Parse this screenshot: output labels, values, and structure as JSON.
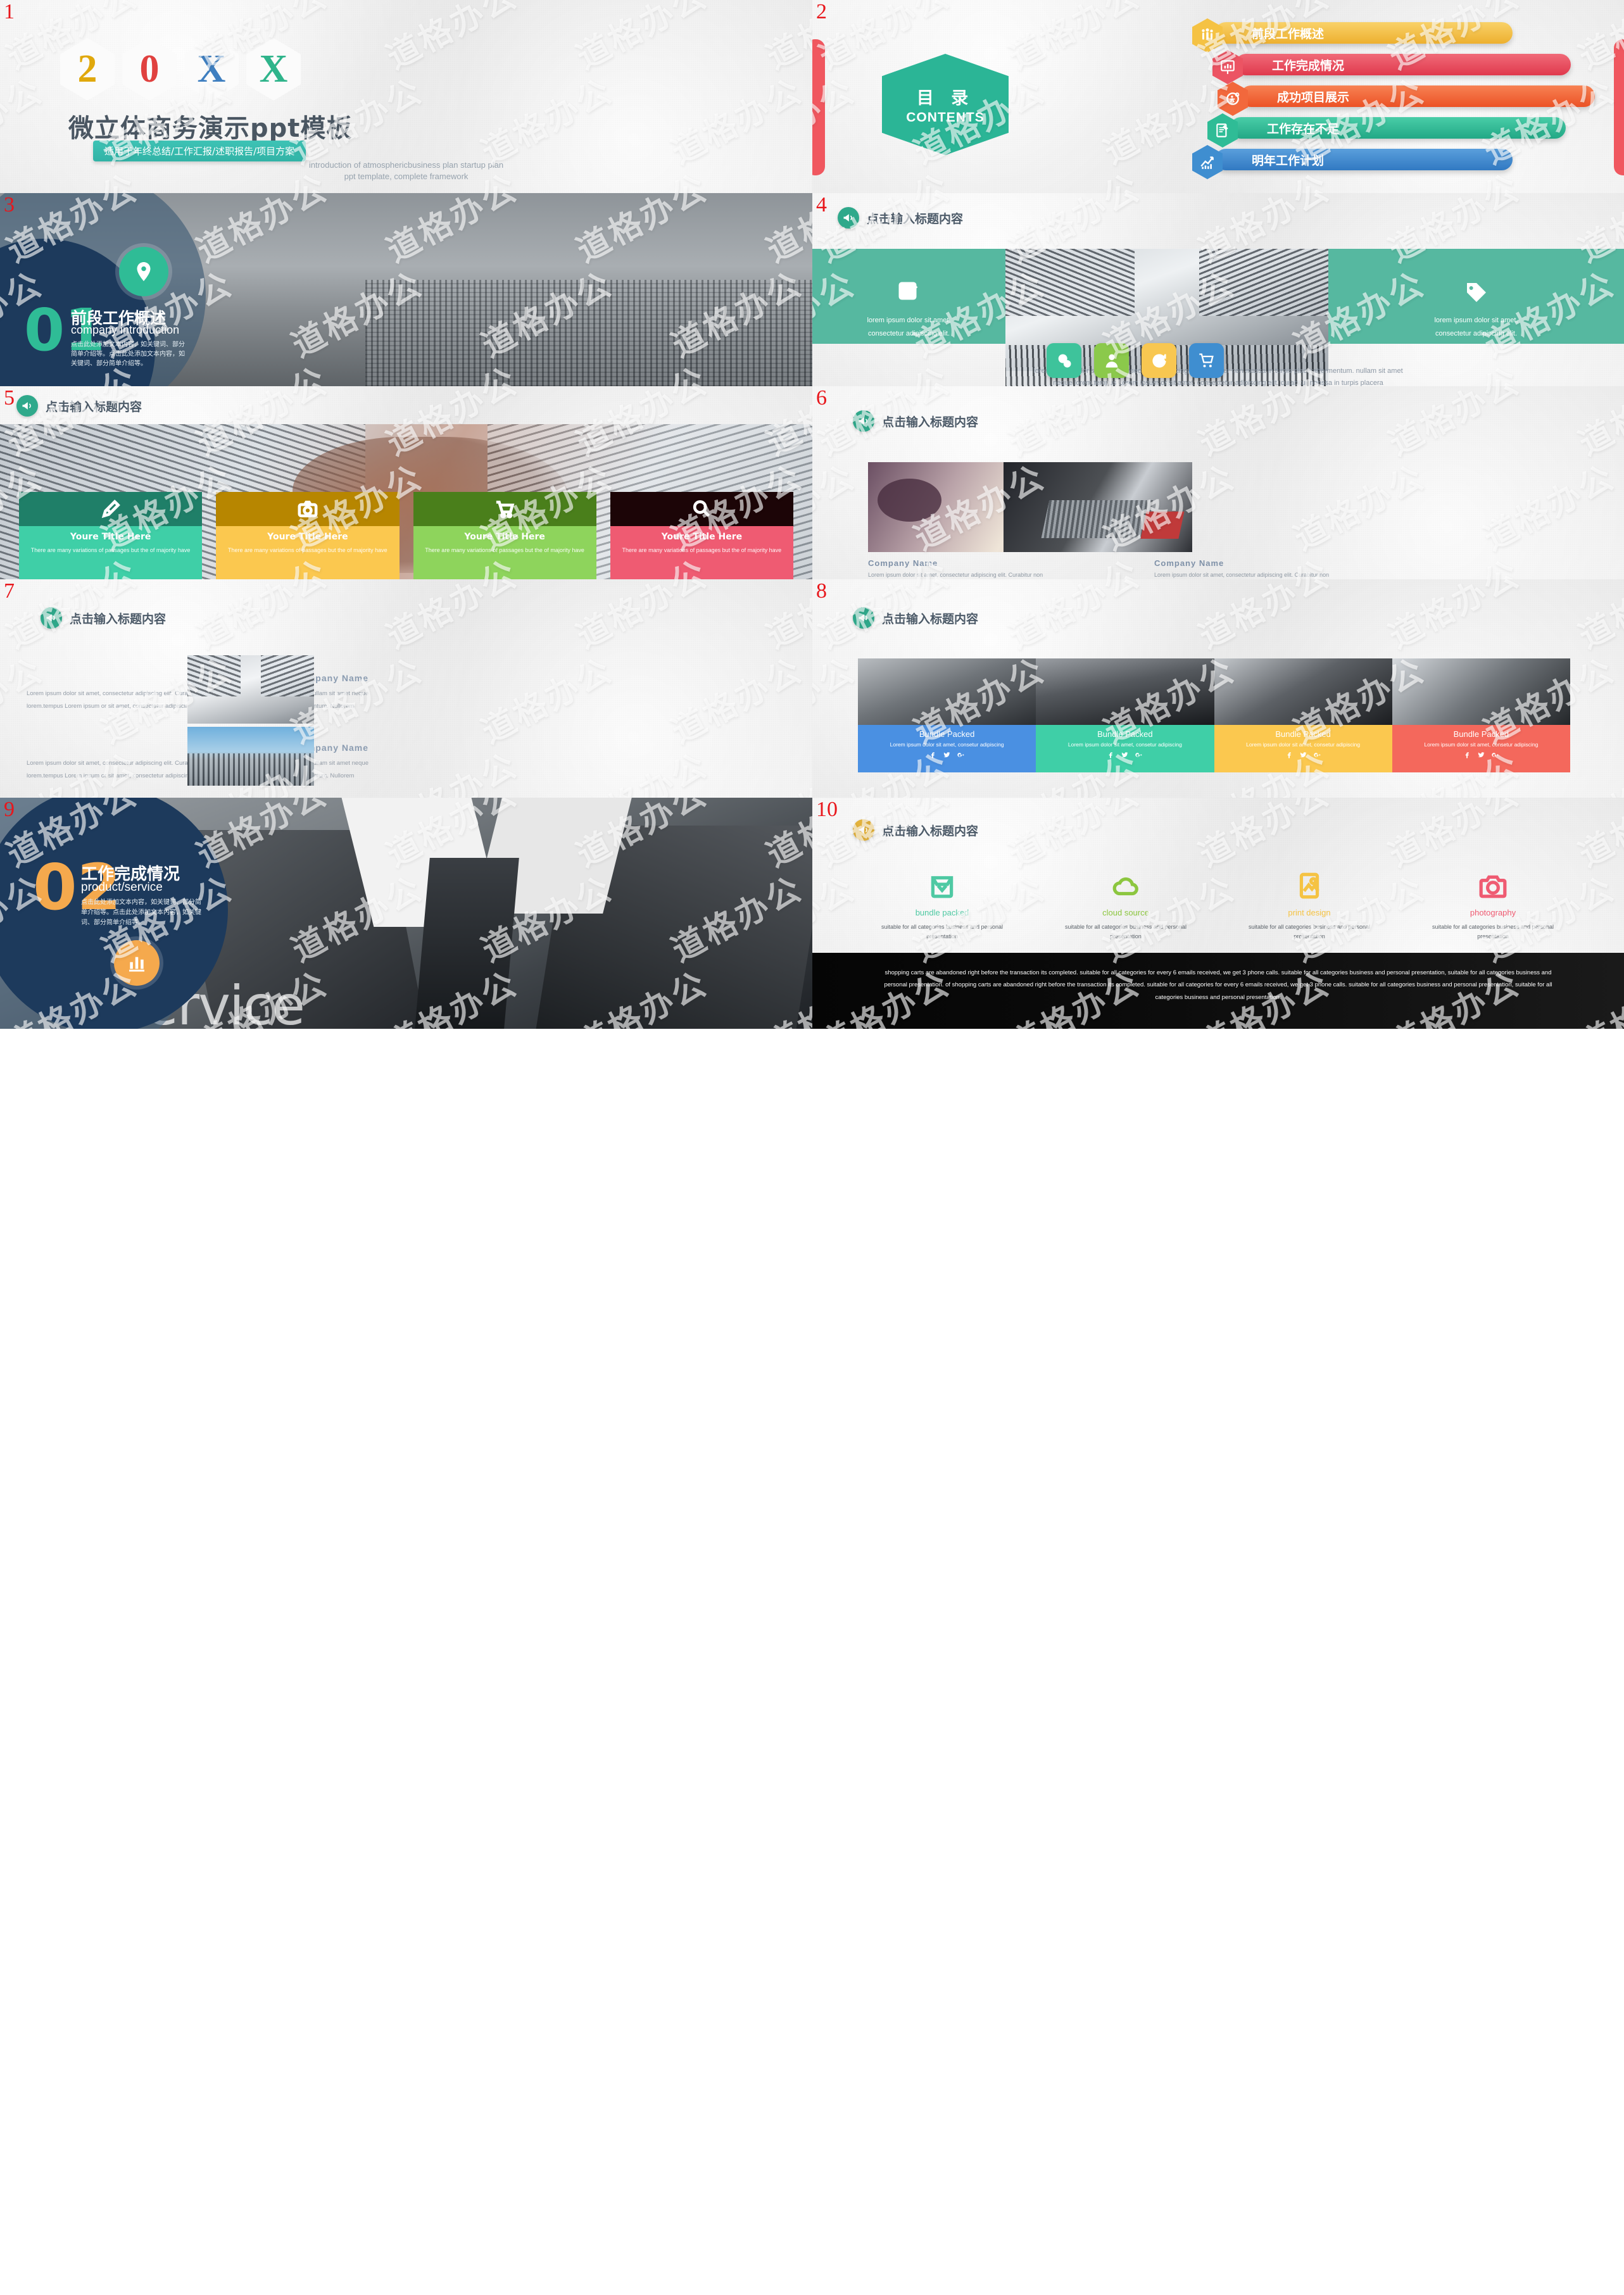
{
  "slides": [
    {
      "number": "1",
      "year_chars": [
        "2",
        "0",
        "X",
        "X"
      ],
      "title": "微立体商务演示ppt模板",
      "pill": "适用于年终总结/工作汇报/述职报告/项目方案",
      "sub_line1": "introduction of atmosphericbusiness plan startup plan",
      "sub_line2": "ppt template, complete framework"
    },
    {
      "number": "2",
      "contents_cn": "目  录",
      "contents_en": "CONTENTS",
      "items": [
        {
          "label": "前段工作概述",
          "color": "#f5c243",
          "icon": "people-icon"
        },
        {
          "label": "工作完成情况",
          "color": "#ec5463",
          "icon": "presentation-chart-icon"
        },
        {
          "label": "成功项目展示",
          "color": "#f2683c",
          "icon": "gear-person-icon"
        },
        {
          "label": "工作存在不足",
          "color": "#2fbc96",
          "icon": "document-pen-icon"
        },
        {
          "label": "明年工作计划",
          "color": "#3f8ed0",
          "icon": "growth-chart-icon"
        }
      ]
    },
    {
      "number": "3",
      "section_no": "01",
      "title_cn": "前段工作概述",
      "title_en": "company introduction",
      "body": "点击此处添加文本内容，如关键词、部分简单介绍等。点击此处添加文本内容，如关键词、部分简单介绍等。",
      "icon": "map-pin-icon",
      "accent": "#2fbc96"
    },
    {
      "number": "4",
      "header": "点击输入标题内容",
      "header_badge_color": "#2fa98b",
      "left_text": "lorem ipsum dolor sit amet, consectetur adipiscing elit.",
      "right_text": "lorem ipsum dolor sit amet, consectetur adipiscing elit.",
      "left_icon": "edit-square-icon",
      "right_icon": "tag-icon",
      "icons": [
        {
          "name": "chat-bubbles-icon",
          "color": "#3ec39b"
        },
        {
          "name": "user-icon",
          "color": "#8bc94b"
        },
        {
          "name": "refresh-clock-icon",
          "color": "#f8c751"
        },
        {
          "name": "shopping-cart-icon",
          "color": "#3f8ed0"
        }
      ],
      "footer_line1": "lorem ipsum dolor sit amet, consectetur adipiscing elit. curabitur non massa in turpis placeratfermentum. nullam sit amet",
      "footer_line2": "neque lorem.tempus Lorem ipsum or sit amet, consectetur adipiscing elit. curabitur nonssa in turpis placera"
    },
    {
      "number": "5",
      "header": "点击输入标题内容",
      "header_badge_color": "#2fa98b",
      "cards": [
        {
          "title": "Youre Title Here",
          "desc": "There are many variations of passages but the of majority have",
          "head_color": "#1f7f68",
          "body_color": "#3fcfa7",
          "icon": "pencil-icon"
        },
        {
          "title": "Youre Title Here",
          "desc": "There are many variations of passages but the of majority have",
          "head_color": "#b78600",
          "body_color": "#fbc84f",
          "icon": "camera-icon"
        },
        {
          "title": "Youre Title Here",
          "desc": "There are many variations of passages but the of majority have",
          "head_color": "#4a7f1b",
          "body_color": "#8ed45c",
          "icon": "cart-icon"
        },
        {
          "title": "Youre Title Here",
          "desc": "There are many variations of passages but the of majority have",
          "head_color": "#1c0507",
          "body_color": "#ef5b72",
          "icon": "search-icon"
        }
      ]
    },
    {
      "number": "6",
      "header": "点击输入标题内容",
      "header_badge_color": "#2fa98b",
      "columns": [
        {
          "name": "Company  Name",
          "body": "Lorem ipsum dolor sit amet, consectetur adipiscing elit. Curabitur non massa in turpis placeratfermentum. Nullam sit amet neque lorem.tempus Lorem ipsum or sit amet, consectetur adipiscing elit. Curabitur nonssa in turpis placera"
        },
        {
          "name": "Company  Name",
          "body": "Lorem ipsum dolor sit amet, consectetur adipiscing elit. Curabitur non massa in turpis placeratfermentum. Nullam sit amet neque lorem.tempus Lorem ipsum or sit amet, consectetur adipiscing elit. Curabitur nonssa in turpis placerat\\"
        }
      ]
    },
    {
      "number": "7",
      "header": "点击输入标题内容",
      "header_badge_color": "#2fa98b",
      "blocks": [
        {
          "name": "Company  Name",
          "body": "Lorem ipsum dolor sit amet, consectetur adipiscing elit. Curabitur non massa in turpis placeratfermentum. Nullam sit amet neque lorem.tempus Lorem ipsum or sit amet, consectetur adipiscing elit. Curabitur nonssa in turpis placerat fermentum. Nullorem"
        },
        {
          "name": "Company  Name",
          "body": "Lorem ipsum dolor sit amet, consectetur adipiscing elit. Curabitur non massa in turpis placeratfermentum. Nullam sit amet neque lorem.tempus Lorem ipsum or sit amet, consectetur adipiscing elit. Curabitur nonssa in turpis placerat fermentum. Nullorem"
        }
      ]
    },
    {
      "number": "8",
      "header": "点击输入标题内容",
      "header_badge_color": "#2fa98b",
      "cards": [
        {
          "title": "Bundle Packed",
          "desc": "Lorem ipsum dolor sit amet, consetur adipiscing",
          "color": "#4a90e2"
        },
        {
          "title": "Bundle Packed",
          "desc": "Lorem ipsum dolor sit amet, consetur adipiscing",
          "color": "#3fcfa7"
        },
        {
          "title": "Bundle Packed",
          "desc": "Lorem ipsum dolor sit amet, consetur adipiscing",
          "color": "#fbc84f"
        },
        {
          "title": "Bundle Packed",
          "desc": "Lorem ipsum dolor sit amet, consetur adipiscing",
          "color": "#f4685c"
        }
      ],
      "social": [
        "facebook-icon",
        "twitter-icon",
        "google-plus-icon"
      ]
    },
    {
      "number": "9",
      "section_no": "02",
      "title_cn": "工作完成情况",
      "title_en": "product/service",
      "body": "点击此处添加文本内容，如关键词、部分简单介绍等。点击此处添加文本内容，如关键词、部分简单介绍等。",
      "icon": "bar-chart-icon",
      "accent": "#f5a94d",
      "backdrop_word": "service"
    },
    {
      "number": "10",
      "header": "点击输入标题内容",
      "header_badge_color": "#e3b23c",
      "features": [
        {
          "name": "bundle packed",
          "desc": "suitable  for all categories  business  and personal  presentation",
          "color": "#4fc9a3",
          "icon": "package-icon"
        },
        {
          "name": "cloud source",
          "desc": "suitable  for all categories  business  and personal  presentation",
          "color": "#8cc63f",
          "icon": "cloud-icon"
        },
        {
          "name": "print design",
          "desc": "suitable  for all categories  business  and personal  presentation",
          "color": "#f5c343",
          "icon": "image-icon"
        },
        {
          "name": "photography",
          "desc": "suitable  for all categories  business  and personal  presentation",
          "color": "#ef5b72",
          "icon": "camera-icon"
        }
      ],
      "footer": "shopping carts are abandoned right before the transaction its completed. suitable for all categories for every 6 emails received, we get 3 phone calls. suitable for all categories business and personal presentation, suitable for all categories business and personal presentation. of shopping carts are abandoned right before the transaction its completed. suitable for all categories for every 6 emails received, we get 3 phone calls. suitable for all categories business and personal presentation, suitable for all categories business and personal presentation."
    }
  ],
  "watermark": {
    "text": "道格办公"
  }
}
